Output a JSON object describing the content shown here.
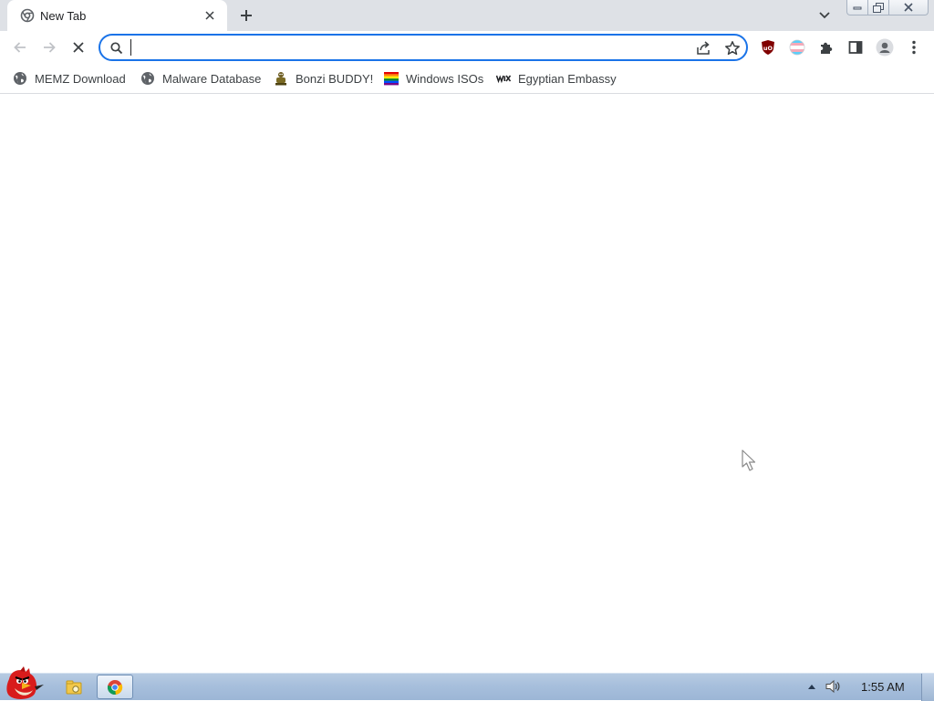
{
  "browser": {
    "tab": {
      "title": "New Tab"
    },
    "omnibox": {
      "value": "",
      "placeholder": ""
    },
    "bookmarks": [
      {
        "label": "MEMZ Download",
        "icon": "globe-icon"
      },
      {
        "label": "Malware Database",
        "icon": "globe-icon"
      },
      {
        "label": "Bonzi BUDDY!",
        "icon": "bonzi-icon"
      },
      {
        "label": "Windows ISOs",
        "icon": "rainbow-flag-icon"
      },
      {
        "label": "Egyptian Embassy",
        "icon": "wix-icon"
      }
    ],
    "extensions": [
      "ublock-icon",
      "trans-flag-extension-icon",
      "puzzle-icon",
      "side-panel-icon",
      "profile-icon",
      "menu-icon"
    ],
    "accent_color": "#1a73e8"
  },
  "taskbar": {
    "clock": "1:55 AM",
    "apps": [
      "explorer-icon",
      "chrome-icon"
    ]
  }
}
